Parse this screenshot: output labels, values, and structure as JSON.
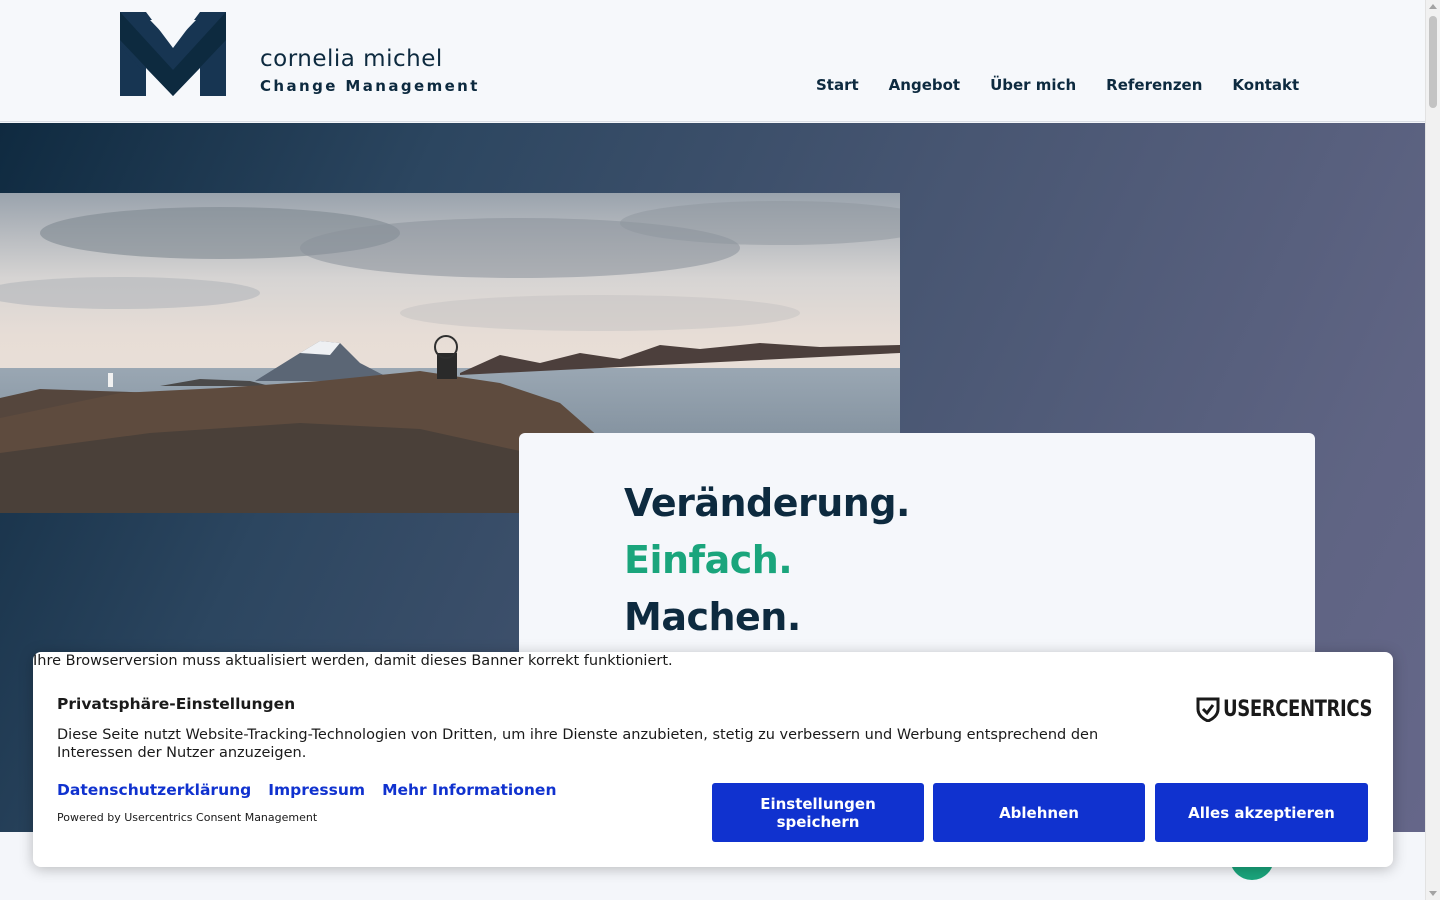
{
  "header": {
    "brand_name": "cornelia michel",
    "brand_sub": "Change Management",
    "nav": [
      "Start",
      "Angebot",
      "Über mich",
      "Referenzen",
      "Kontakt"
    ]
  },
  "hero": {
    "slogan": [
      "Veränderung.",
      "Einfach.",
      "Machen."
    ]
  },
  "consent": {
    "browser_warning": "Ihre Browserversion muss aktualisiert werden, damit dieses Banner korrekt funktioniert.",
    "title": "Privatsphäre-Einstellungen",
    "text": "Diese Seite nutzt Website-Tracking-Technologien von Dritten, um ihre Dienste anzubieten, stetig zu verbessern und Werbung entsprechend den Interessen der Nutzer anzuzeigen.",
    "links": [
      "Datenschutzerklärung",
      "Impressum",
      "Mehr Informationen"
    ],
    "powered_by": "Powered by Usercentrics Consent Management",
    "logo_text": "USERCENTRICS",
    "buttons": {
      "save": "Einstellungen speichern",
      "deny": "Ablehnen",
      "accept": "Alles akzeptieren"
    }
  },
  "colors": {
    "navy": "#0d2a3f",
    "accent_green": "#1aa57c",
    "consent_blue": "#1032cf"
  }
}
